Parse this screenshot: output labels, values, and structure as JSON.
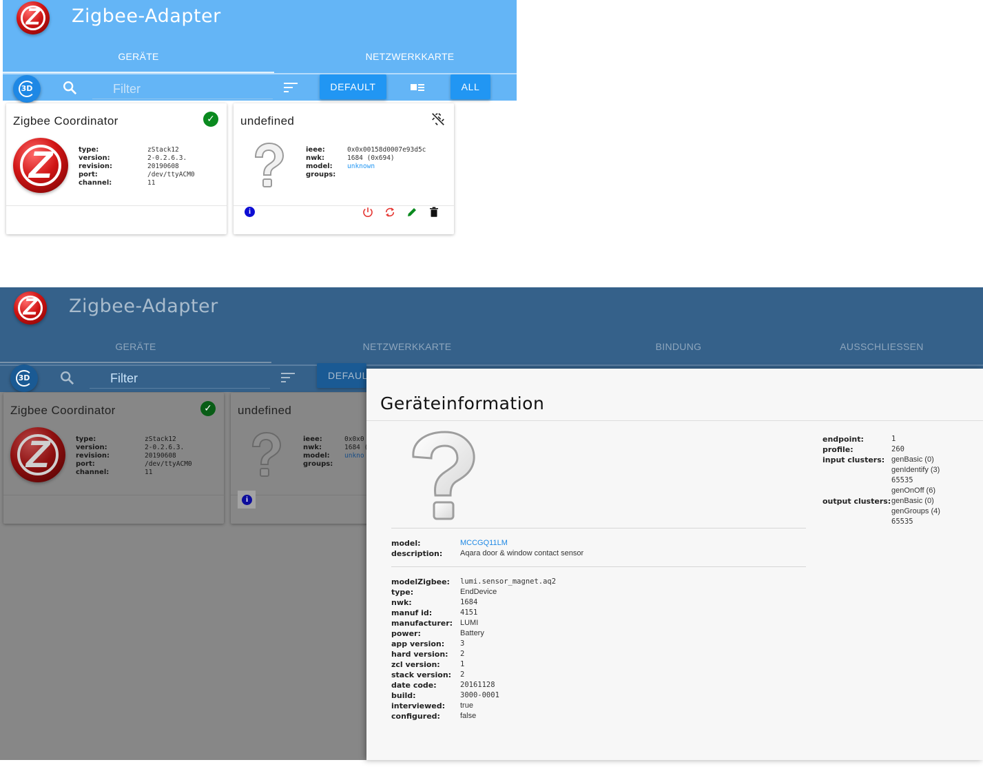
{
  "app": {
    "title": "Zigbee-Adapter"
  },
  "tabs_top": [
    "GERÄTE",
    "NETZWERKKARTE"
  ],
  "tabs_bottom": [
    "GERÄTE",
    "NETZWERKKARTE",
    "BINDUNG",
    "AUSSCHLIESSEN"
  ],
  "toolbar": {
    "btn_3d": "3D",
    "filter_placeholder": "Filter",
    "default_label": "DEFAULT",
    "default_label_cut": "DEFAUL",
    "all_label": "ALL"
  },
  "coordinator": {
    "title": "Zigbee Coordinator",
    "props": [
      {
        "k": "type:",
        "v": "zStack12"
      },
      {
        "k": "version:",
        "v": "2-0.2.6.3."
      },
      {
        "k": "revision:",
        "v": "20190608"
      },
      {
        "k": "port:",
        "v": "/dev/ttyACM0"
      },
      {
        "k": "channel:",
        "v": "11"
      }
    ]
  },
  "device": {
    "title": "undefined",
    "props": [
      {
        "k": "ieee:",
        "v": "0x0x00158d0007e93d5c"
      },
      {
        "k": "nwk:",
        "v": "1684 (0x694)"
      },
      {
        "k": "model:",
        "v": "unknown"
      },
      {
        "k": "groups:",
        "v": ""
      }
    ],
    "props_cut": [
      {
        "k": "ieee:",
        "v": "0x0x0"
      },
      {
        "k": "nwk:",
        "v": "1684 ("
      },
      {
        "k": "model:",
        "v": "unkno"
      },
      {
        "k": "groups:",
        "v": ""
      }
    ]
  },
  "dialog": {
    "title": "Geräteinformation",
    "model_block": [
      {
        "k": "model:",
        "v": "MCCGQ11LM"
      },
      {
        "k": "description:",
        "v": "Aqara door & window contact sensor"
      }
    ],
    "info": [
      {
        "k": "modelZigbee:",
        "v": "lumi.sensor_magnet.aq2"
      },
      {
        "k": "type:",
        "v": "EndDevice"
      },
      {
        "k": "nwk:",
        "v": "1684"
      },
      {
        "k": "manuf id:",
        "v": "4151"
      },
      {
        "k": "manufacturer:",
        "v": "LUMI"
      },
      {
        "k": "power:",
        "v": "Battery"
      },
      {
        "k": "app version:",
        "v": "3"
      },
      {
        "k": "hard version:",
        "v": "2"
      },
      {
        "k": "zcl version:",
        "v": "1"
      },
      {
        "k": "stack version:",
        "v": "2"
      },
      {
        "k": "date code:",
        "v": "20161128"
      },
      {
        "k": "build:",
        "v": "3000-0001"
      },
      {
        "k": "interviewed:",
        "v": "true"
      },
      {
        "k": "configured:",
        "v": "false"
      }
    ],
    "endpoint": [
      {
        "k": "endpoint:",
        "v": "1"
      },
      {
        "k": "profile:",
        "v": "260"
      },
      {
        "k": "input clusters:",
        "v": "genBasic (0)"
      },
      {
        "k": "",
        "v": "genIdentify (3)"
      },
      {
        "k": "",
        "v": "65535"
      },
      {
        "k": "",
        "v": "genOnOff (6)"
      },
      {
        "k": "output clusters:",
        "v": "genBasic (0)"
      },
      {
        "k": "",
        "v": "genGroups (4)"
      },
      {
        "k": "",
        "v": "65535"
      }
    ]
  },
  "colors": {
    "header_light": "#64b5f6",
    "header_dark": "#35618a",
    "accent": "#2196f3",
    "ok": "#0a8a1f",
    "danger": "#e53935",
    "edit": "#0a8a1f"
  },
  "icons": [
    "zigbee-logo-icon",
    "3d-icon",
    "search-icon",
    "sort-icon",
    "card-view-icon",
    "check-circle-icon",
    "link-off-icon",
    "info-icon",
    "power-icon",
    "refresh-icon",
    "pencil-icon",
    "delete-icon",
    "question-mark-icon"
  ]
}
